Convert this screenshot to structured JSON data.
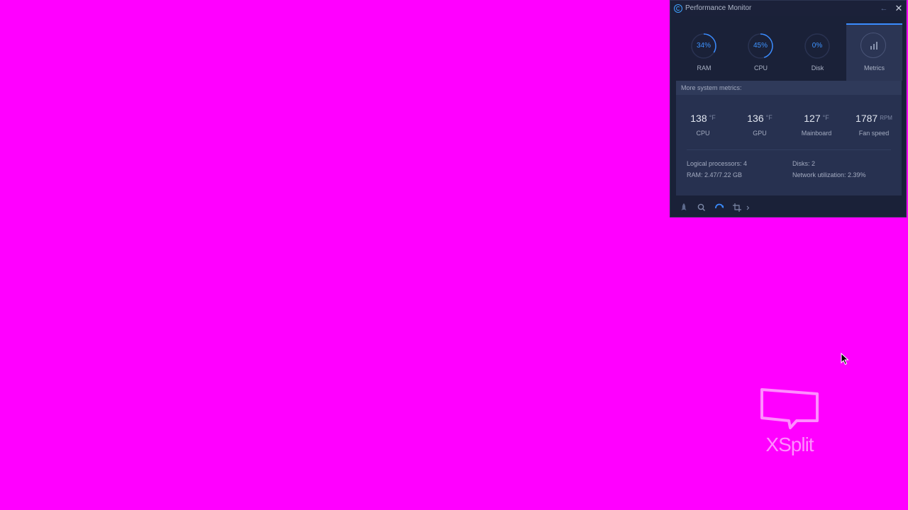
{
  "window": {
    "title": "Performance Monitor"
  },
  "tabs": [
    {
      "id": "ram",
      "value_label": "34%",
      "value": 34,
      "label": "RAM"
    },
    {
      "id": "cpu",
      "value_label": "45%",
      "value": 45,
      "label": "CPU"
    },
    {
      "id": "disk",
      "value_label": "0%",
      "value": 0,
      "label": "Disk"
    },
    {
      "id": "metrics",
      "label": "Metrics",
      "icon": "bar-chart-icon",
      "active": true
    }
  ],
  "metrics": {
    "header": "More system metrics:",
    "temperatures": [
      {
        "value": "138",
        "unit": "°F",
        "label": "CPU"
      },
      {
        "value": "136",
        "unit": "°F",
        "label": "GPU"
      },
      {
        "value": "127",
        "unit": "°F",
        "label": "Mainboard"
      },
      {
        "value": "1787",
        "unit": "RPM",
        "label": "Fan speed"
      }
    ],
    "info": {
      "logical_processors": "Logical processors: 4",
      "ram": "RAM: 2.47/7.22 GB",
      "disks": "Disks: 2",
      "network": "Network utilization: 2.39%"
    }
  },
  "footer": {
    "buttons": [
      "rocket-icon",
      "search-icon",
      "refresh-icon",
      "crop-icon",
      "chevron-right-icon"
    ]
  },
  "watermark": {
    "text": "XSplit"
  },
  "colors": {
    "desktop_background": "#ff00ff",
    "accent": "#3a8cff",
    "window_background": "#1a2138",
    "panel_background": "#273150"
  }
}
